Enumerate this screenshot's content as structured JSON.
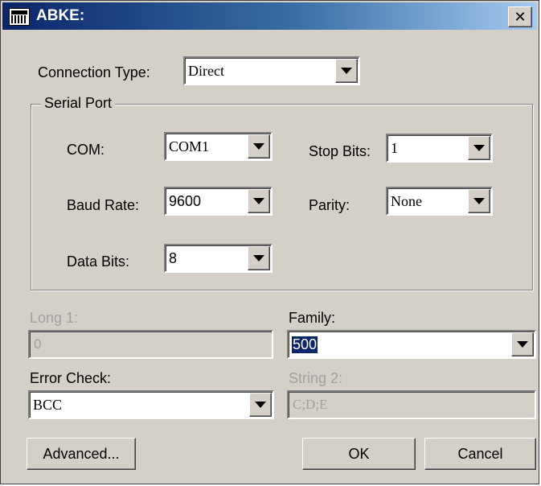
{
  "window": {
    "title": "ABKE:",
    "close_glyph": "✕"
  },
  "icons": {
    "app": "keyboard-icon",
    "close": "close-icon",
    "dropdown": "chevron-down-icon"
  },
  "connection": {
    "label": "Connection Type:",
    "value": "Direct"
  },
  "serial_port": {
    "legend": "Serial Port",
    "com": {
      "label": "COM:",
      "value": "COM1"
    },
    "baud_rate": {
      "label": "Baud Rate:",
      "value": "9600"
    },
    "data_bits": {
      "label": "Data Bits:",
      "value": "8"
    },
    "stop_bits": {
      "label": "Stop Bits:",
      "value": "1"
    },
    "parity": {
      "label": "Parity:",
      "value": "None"
    }
  },
  "long1": {
    "label": "Long 1:",
    "value": "0",
    "disabled": true
  },
  "family": {
    "label": "Family:",
    "value": "500"
  },
  "error_check": {
    "label": "Error Check:",
    "value": "BCC"
  },
  "string2": {
    "label": "String 2:",
    "value": "C;D;E",
    "disabled": true
  },
  "buttons": {
    "advanced": "Advanced...",
    "ok": "OK",
    "cancel": "Cancel"
  },
  "colors": {
    "titlebar_start": "#0a246a",
    "titlebar_end": "#a6caf0",
    "face": "#d4d0c8",
    "selection": "#0a246a"
  }
}
